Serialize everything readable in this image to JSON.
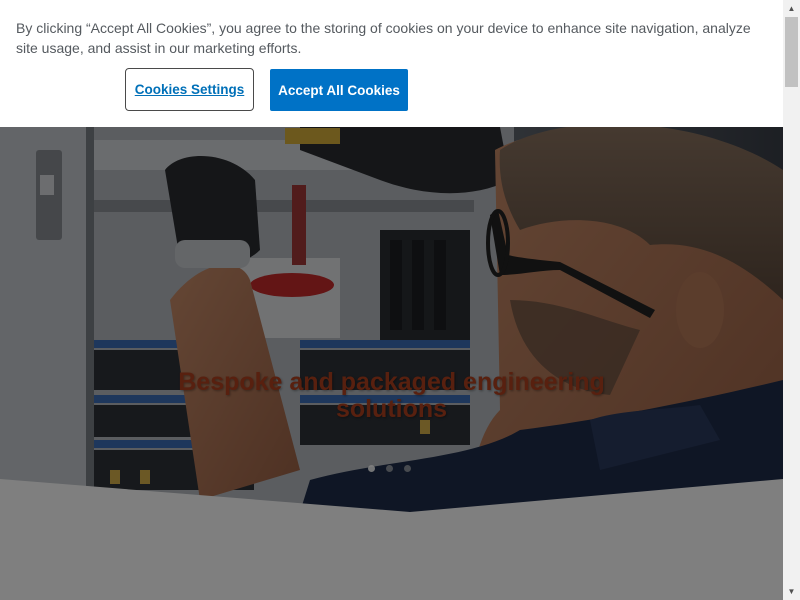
{
  "cookie_banner": {
    "message": "By clicking “Accept All Cookies”, you agree to the storing of cookies on your device to enhance site navigation, analyze site usage, and assist in our marketing efforts.",
    "settings_label": "Cookies Settings",
    "accept_label": "Accept All Cookies"
  },
  "hero": {
    "title": "Bespoke and packaged engineering solutions",
    "slides": 3,
    "active_slide": 1
  },
  "colors": {
    "accent_button": "#0072c6",
    "settings_link": "#0070b8",
    "hero_title": "#b0401f"
  },
  "icons": {
    "scroll_up": "▲",
    "scroll_down": "▼"
  }
}
